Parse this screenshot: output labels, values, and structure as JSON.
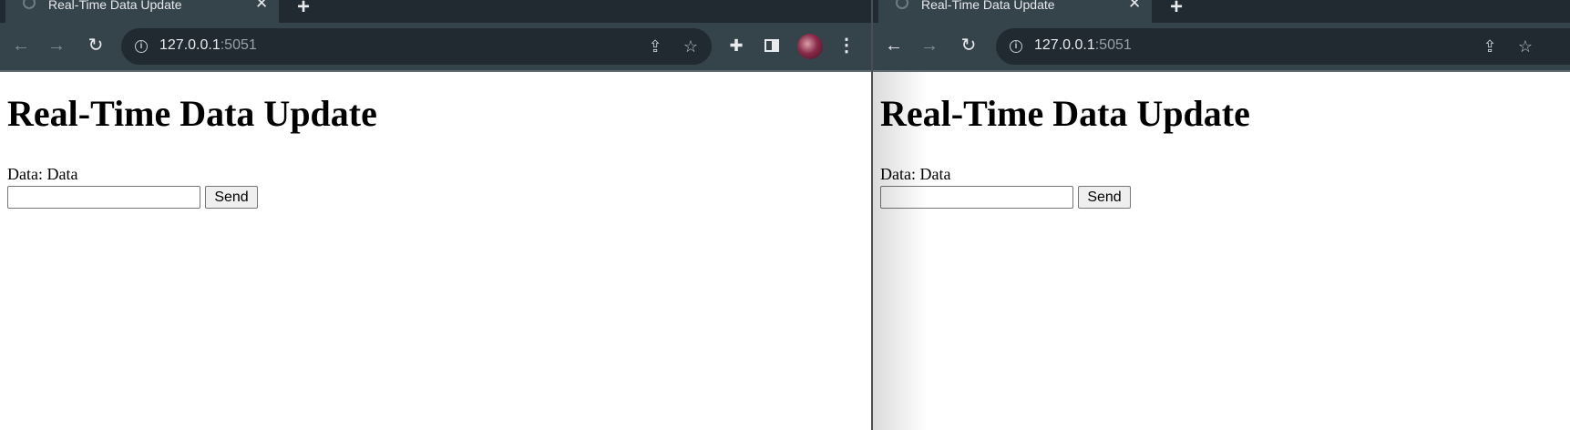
{
  "windows": [
    {
      "tab": {
        "title": "Real-Time Data Update"
      },
      "address": {
        "host": "127.0.0.1",
        "port": ":5051"
      },
      "page": {
        "heading": "Real-Time Data Update",
        "data_label": "Data: ",
        "data_value": "Data",
        "input_value": "",
        "send_label": "Send"
      }
    },
    {
      "tab": {
        "title": "Real-Time Data Update"
      },
      "address": {
        "host": "127.0.0.1",
        "port": ":5051"
      },
      "page": {
        "heading": "Real-Time Data Update",
        "data_label": "Data: ",
        "data_value": "Data",
        "input_value": "",
        "send_label": "Send"
      }
    }
  ],
  "icons": {
    "back": "arrow-left",
    "forward": "arrow-right",
    "reload": "reload",
    "info": "info-circle",
    "share": "share",
    "bookmark": "star",
    "extensions": "puzzle",
    "side_panel": "side-panel",
    "menu": "kebab"
  },
  "colors": {
    "tabstrip": "#202a30",
    "toolbar": "#35434b",
    "omnibox": "#202a30"
  }
}
